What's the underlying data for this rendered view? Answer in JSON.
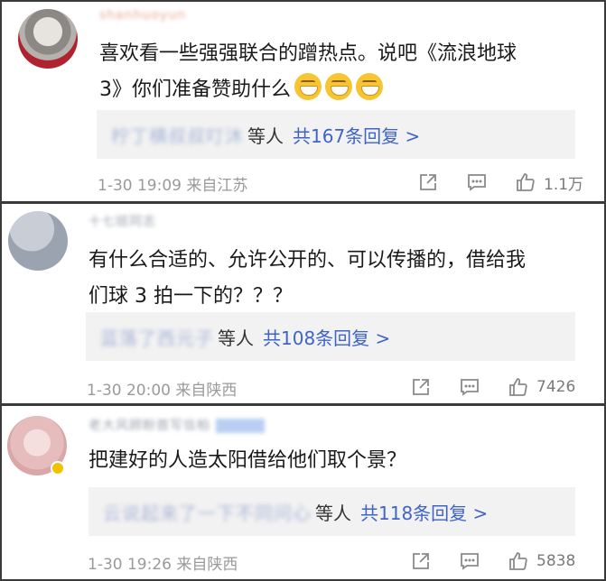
{
  "comments": [
    {
      "username": "shanhuoyun",
      "text": "喜欢看一些强强联合的蹭热点。说吧《流浪地球\n3》你们准备赞助什么",
      "emoji_count": 3,
      "reply_names": "柠丁横叔叔叮沐",
      "reply_etc": "等人",
      "reply_count": "共167条回复 >",
      "time": "1-30 19:09",
      "location": "来自江苏",
      "likes": "1.1万",
      "icons": [
        "share-icon",
        "comment-icon",
        "like-icon"
      ]
    },
    {
      "username": "十七班同志",
      "text": "有什么合适的、允许公开的、可以传播的，借给我\n们球 3 拍一下的？？？",
      "reply_names": "蓝落了西元子",
      "reply_etc": "等人",
      "reply_count": "共108条回复 >",
      "time": "1-30 20:00",
      "location": "来自陕西",
      "likes": "7426",
      "icons": [
        "share-icon",
        "comment-icon",
        "like-icon"
      ]
    },
    {
      "username": "老大风顾盼首写信柏",
      "text": "把建好的人造太阳借给他们取个景？",
      "reply_names": "云说起来了一下不同问心",
      "reply_etc": "等人",
      "reply_count": "共118条回复 >",
      "time": "1-30 19:26",
      "location": "来自陕西",
      "likes": "5838",
      "icons": [
        "share-icon",
        "comment-icon",
        "like-icon"
      ]
    }
  ],
  "colors": {
    "link": "#3f64c8",
    "meta": "#9a9a9a",
    "reply_bg": "#f2f2f2"
  }
}
